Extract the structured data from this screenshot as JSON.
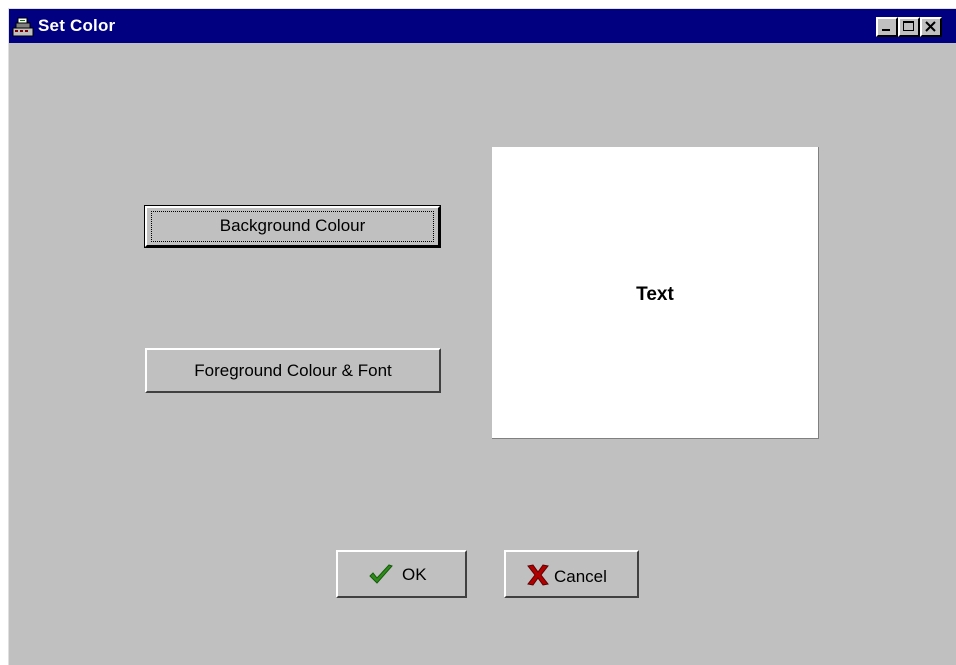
{
  "window": {
    "title": "Set Color",
    "app_icon": "cash-register-icon",
    "controls": [
      "minimize-icon",
      "maximize-icon",
      "close-icon"
    ]
  },
  "buttons": {
    "background_colour": "Background Colour",
    "foreground_colour_font": "Foreground Colour & Font",
    "ok": "OK",
    "cancel": "Cancel"
  },
  "preview": {
    "text": "Text",
    "background_color": "#ffffff",
    "text_color": "#000000"
  },
  "icons": {
    "ok": "checkmark-icon",
    "cancel": "red-x-icon"
  },
  "colors": {
    "titlebar": "#000080",
    "dialog_face": "#c0c0c0",
    "ok_check": "#2e8b1a",
    "cancel_x": "#b00000"
  }
}
